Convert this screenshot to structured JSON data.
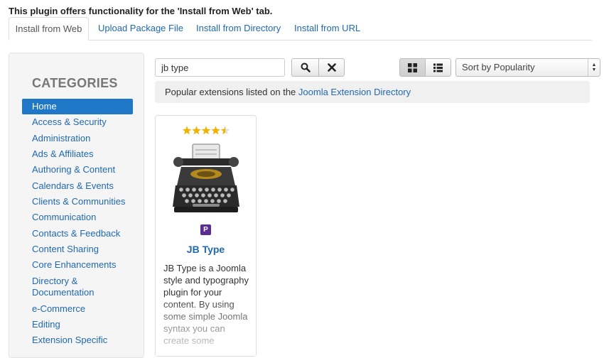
{
  "notice": "This plugin offers functionality for the 'Install from Web' tab.",
  "tabs": [
    {
      "label": "Install from Web"
    },
    {
      "label": "Upload Package File"
    },
    {
      "label": "Install from Directory"
    },
    {
      "label": "Install from URL"
    }
  ],
  "sidebar": {
    "header": "CATEGORIES",
    "items": [
      {
        "label": "Home"
      },
      {
        "label": "Access & Security"
      },
      {
        "label": "Administration"
      },
      {
        "label": "Ads & Affiliates"
      },
      {
        "label": "Authoring & Content"
      },
      {
        "label": "Calendars & Events"
      },
      {
        "label": "Clients & Communities"
      },
      {
        "label": "Communication"
      },
      {
        "label": "Contacts & Feedback"
      },
      {
        "label": "Content Sharing"
      },
      {
        "label": "Core Enhancements"
      },
      {
        "label": "Directory & Documentation"
      },
      {
        "label": "e-Commerce"
      },
      {
        "label": "Editing"
      },
      {
        "label": "Extension Specific"
      }
    ]
  },
  "search": {
    "value": "jb type"
  },
  "sort": {
    "selected": "Sort by Popularity"
  },
  "info": {
    "prefix": "Popular extensions listed on the ",
    "link": "Joomla Extension Directory"
  },
  "card": {
    "rating_stars": 4.5,
    "badge": "P",
    "title": "JB Type",
    "description": "JB Type is a Joomla style and typography plugin for your content. By using some simple Joomla syntax you can create some"
  },
  "colors": {
    "link": "#1f69b0",
    "active": "#1f77c8",
    "badge": "#5c2d91",
    "stars": "#f0b400"
  }
}
